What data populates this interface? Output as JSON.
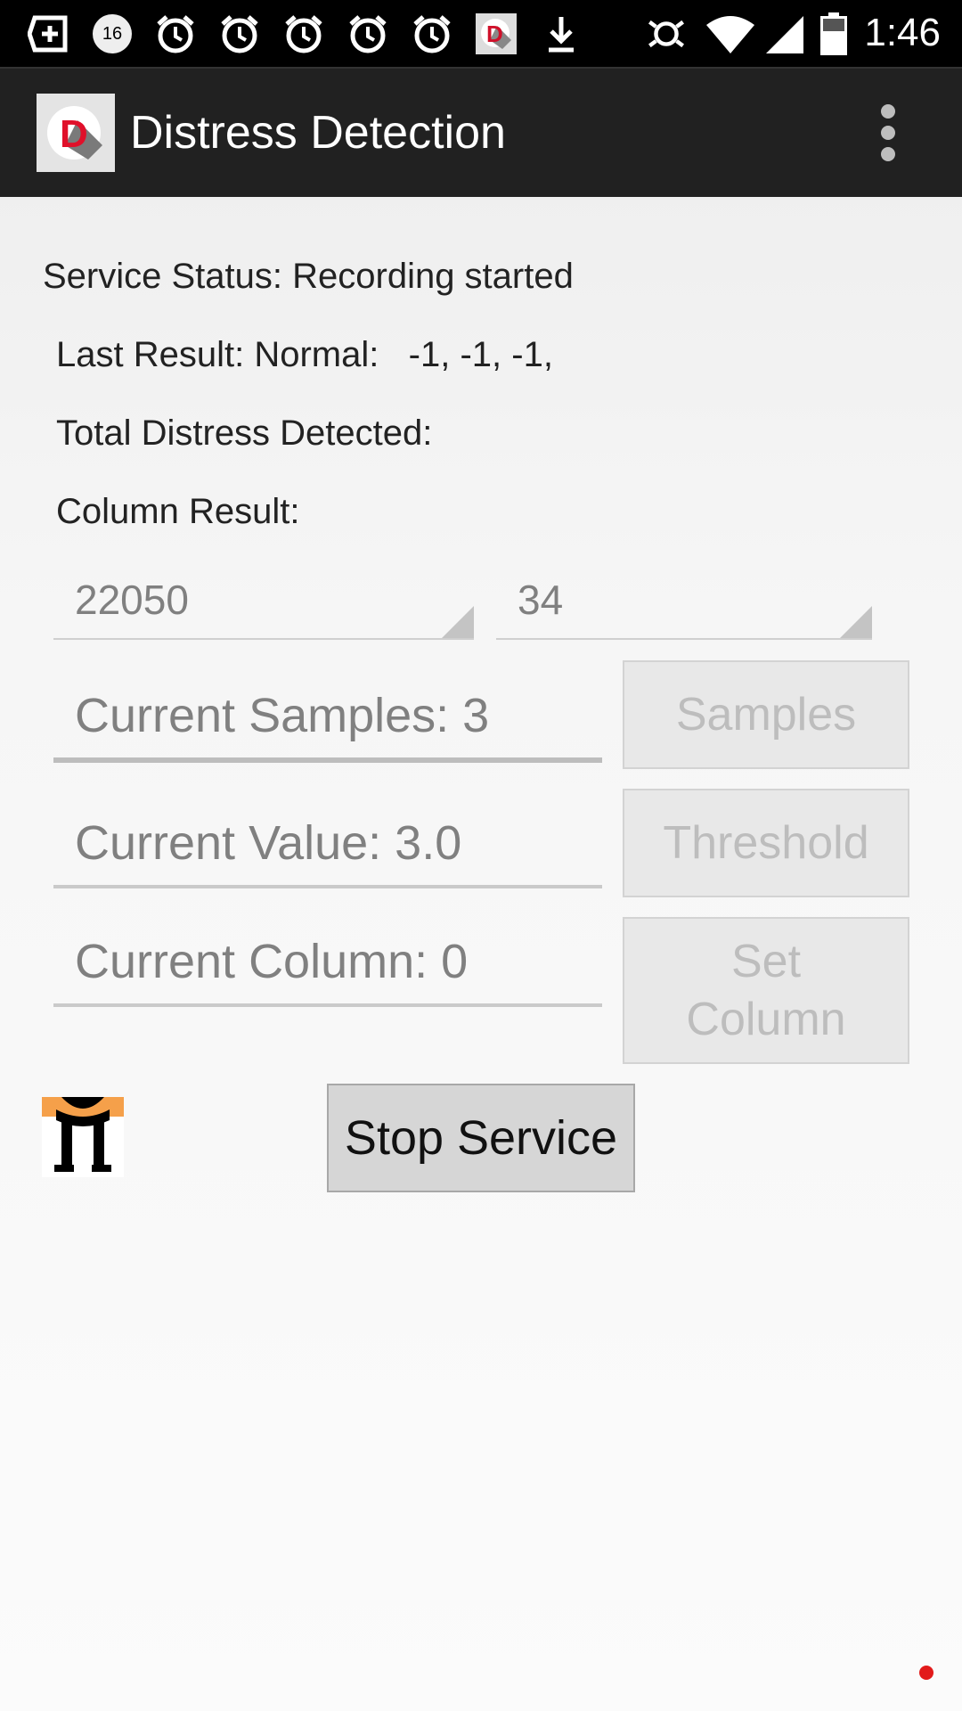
{
  "status_bar": {
    "time": "1:46",
    "notification_badge": "16",
    "icons": [
      "add-box-icon",
      "badge-16-icon",
      "alarm-icon",
      "alarm-icon",
      "alarm-icon",
      "alarm-icon",
      "alarm-icon",
      "distress-app-icon",
      "download-icon",
      "vibrate-icon",
      "wifi-icon",
      "cell-signal-icon",
      "battery-icon"
    ]
  },
  "action_bar": {
    "title": "Distress Detection",
    "logo_letter": "D"
  },
  "content": {
    "service_status": "Service Status: Recording started",
    "last_result": "Last Result: Normal:   -1, -1, -1,",
    "total_distress": "Total Distress Detected:",
    "column_result": "Column Result:",
    "spinner_rate": "22050",
    "spinner_count": "34",
    "current_samples": "Current Samples: 3",
    "current_value": "Current Value: 3.0",
    "current_column": "Current Column: 0",
    "samples_button": "Samples",
    "threshold_button": "Threshold",
    "set_column_button_line1": "Set",
    "set_column_button_line2": "Column",
    "stop_service_button": "Stop Service"
  },
  "colors": {
    "status_bar": "#000000",
    "action_bar": "#212121",
    "logo_red": "#e0102a",
    "disabled_text": "#bdbdbd",
    "hint_text": "#808080",
    "mascot_orange": "#f5a04a"
  }
}
